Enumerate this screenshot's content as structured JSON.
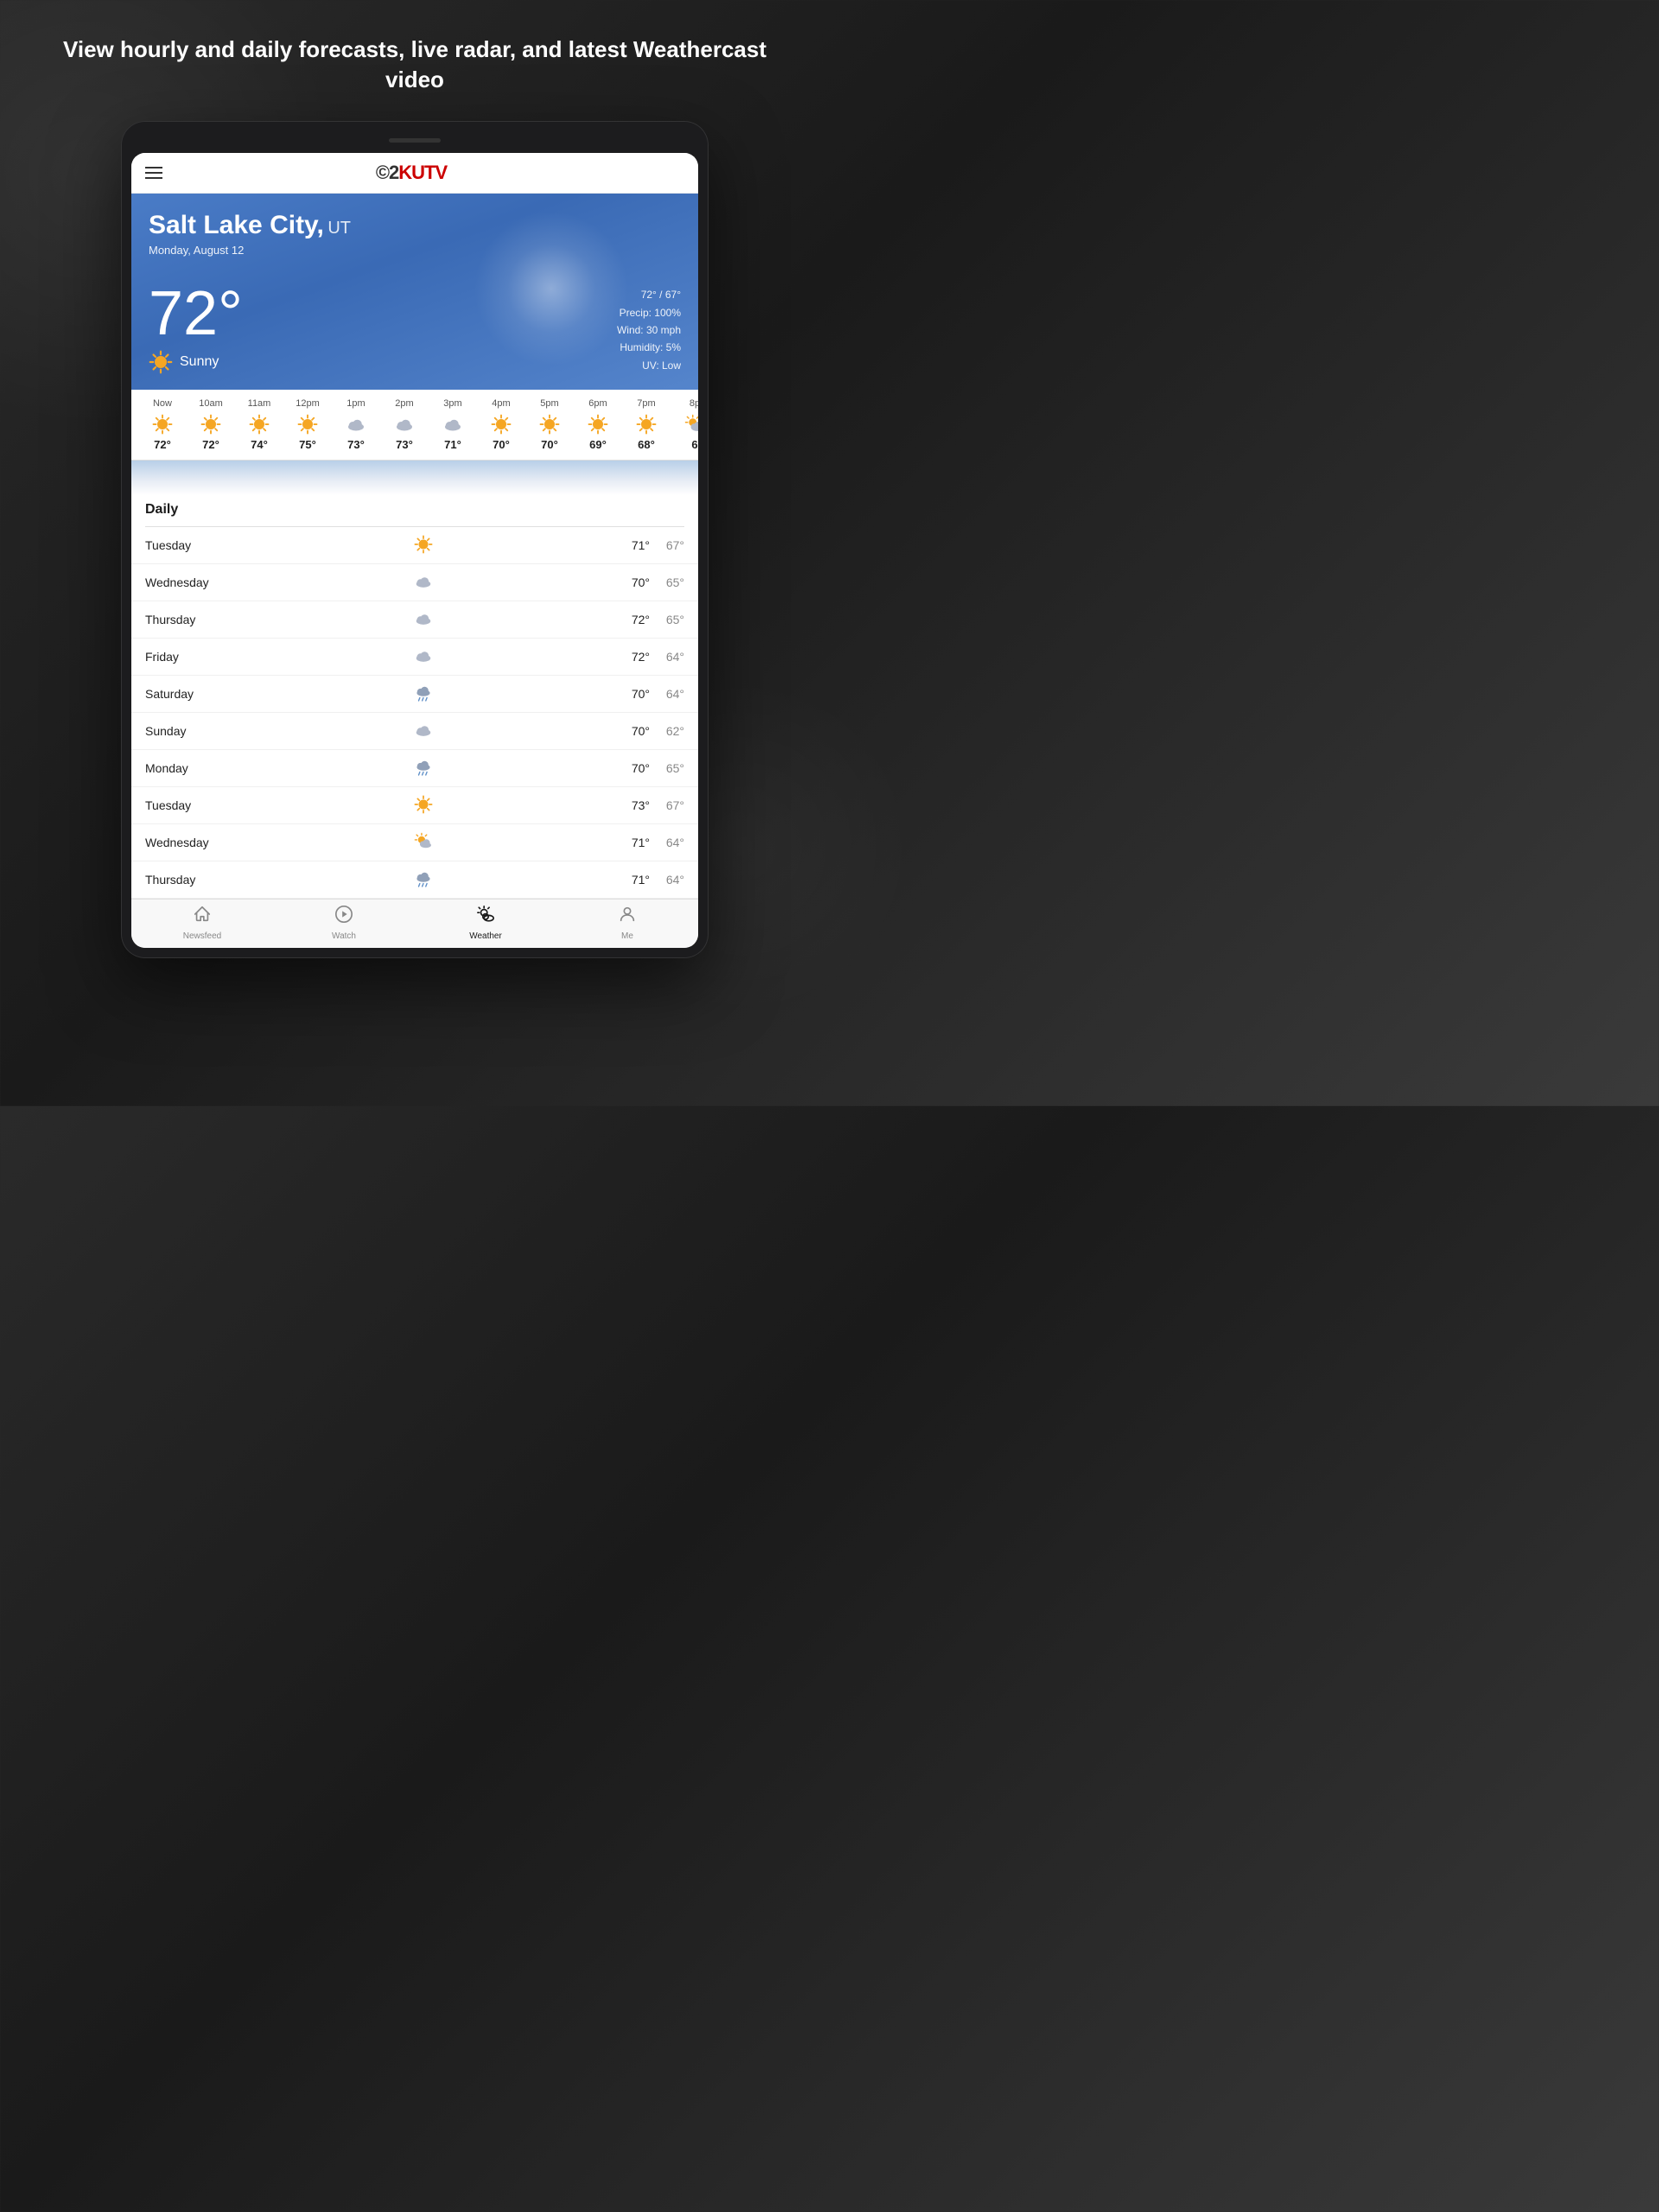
{
  "headline": "View hourly and daily forecasts, live radar,\nand latest Weathercast video",
  "app": {
    "logo": "©2KUTV",
    "logo_cb": "©2",
    "logo_kutv": "KUTV"
  },
  "weather": {
    "city": "Salt Lake City,",
    "state": "UT",
    "date": "Monday, August 12",
    "temp": "72°",
    "condition": "Sunny",
    "high_low": "72° / 67°",
    "precip": "Precip: 100%",
    "wind": "Wind: 30 mph",
    "humidity": "Humidity: 5%",
    "uv": "UV: Low"
  },
  "hourly": [
    {
      "time": "Now",
      "temp": "72°",
      "icon": "sun"
    },
    {
      "time": "10am",
      "temp": "72°",
      "icon": "sun"
    },
    {
      "time": "11am",
      "temp": "74°",
      "icon": "sun"
    },
    {
      "time": "12pm",
      "temp": "75°",
      "icon": "sun"
    },
    {
      "time": "1pm",
      "temp": "73°",
      "icon": "cloud"
    },
    {
      "time": "2pm",
      "temp": "73°",
      "icon": "cloud"
    },
    {
      "time": "3pm",
      "temp": "71°",
      "icon": "cloud"
    },
    {
      "time": "4pm",
      "temp": "70°",
      "icon": "sun"
    },
    {
      "time": "5pm",
      "temp": "70°",
      "icon": "sun"
    },
    {
      "time": "6pm",
      "temp": "69°",
      "icon": "sun"
    },
    {
      "time": "7pm",
      "temp": "68°",
      "icon": "sun"
    },
    {
      "time": "8p",
      "temp": "6",
      "icon": "sun_partial"
    }
  ],
  "daily_label": "Daily",
  "daily": [
    {
      "day": "Tuesday",
      "icon": "sun",
      "high": "71°",
      "low": "67°"
    },
    {
      "day": "Wednesday",
      "icon": "cloud",
      "high": "70°",
      "low": "65°"
    },
    {
      "day": "Thursday",
      "icon": "cloud",
      "high": "72°",
      "low": "65°"
    },
    {
      "day": "Friday",
      "icon": "cloud",
      "high": "72°",
      "low": "64°"
    },
    {
      "day": "Saturday",
      "icon": "cloud_rain",
      "high": "70°",
      "low": "64°"
    },
    {
      "day": "Sunday",
      "icon": "cloud",
      "high": "70°",
      "low": "62°"
    },
    {
      "day": "Monday",
      "icon": "cloud_rain",
      "high": "70°",
      "low": "65°"
    },
    {
      "day": "Tuesday",
      "icon": "sun",
      "high": "73°",
      "low": "67°"
    },
    {
      "day": "Wednesday",
      "icon": "cloud_partial",
      "high": "71°",
      "low": "64°"
    },
    {
      "day": "Thursday",
      "icon": "cloud_rain",
      "high": "71°",
      "low": "64°"
    }
  ],
  "nav": [
    {
      "label": "Newsfeed",
      "icon": "house",
      "active": false
    },
    {
      "label": "Watch",
      "icon": "play_circle",
      "active": false
    },
    {
      "label": "Weather",
      "icon": "weather",
      "active": true
    },
    {
      "label": "Me",
      "icon": "person",
      "active": false
    }
  ]
}
